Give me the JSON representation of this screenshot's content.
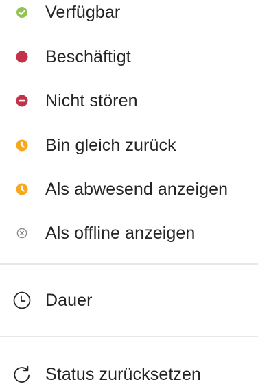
{
  "status_menu": {
    "items": [
      {
        "label": "Verfügbar",
        "icon": "available-check-icon",
        "color": "#92c353"
      },
      {
        "label": "Beschäftigt",
        "icon": "busy-dot-icon",
        "color": "#c4314b"
      },
      {
        "label": "Nicht stören",
        "icon": "do-not-disturb-icon",
        "color": "#c4314b"
      },
      {
        "label": "Bin gleich zurück",
        "icon": "be-right-back-clock-icon",
        "color": "#f8a81d"
      },
      {
        "label": "Als abwesend anzeigen",
        "icon": "away-clock-icon",
        "color": "#f8a81d"
      },
      {
        "label": "Als offline anzeigen",
        "icon": "offline-x-icon",
        "color": "#8a8886"
      }
    ],
    "duration": {
      "label": "Dauer",
      "icon": "clock-outline-icon"
    },
    "reset": {
      "label": "Status zurücksetzen",
      "icon": "refresh-icon"
    }
  }
}
